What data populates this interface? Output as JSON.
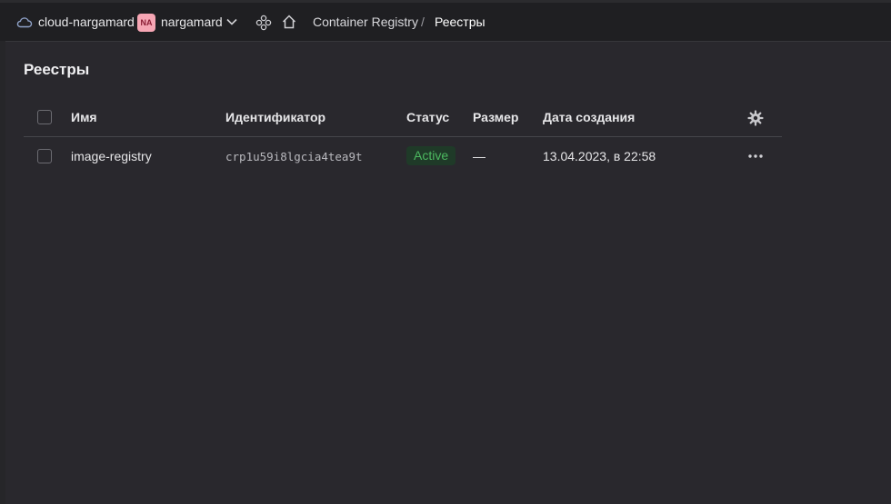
{
  "header": {
    "cloud_name": "cloud-nargamard",
    "folder_avatar": "NA",
    "folder_name": "nargamard",
    "breadcrumb": [
      {
        "label": "Container Registry"
      },
      {
        "label": "Реестры"
      }
    ],
    "breadcrumb_separator": "/"
  },
  "page": {
    "title": "Реестры"
  },
  "table": {
    "columns": [
      "Имя",
      "Идентификатор",
      "Статус",
      "Размер",
      "Дата создания"
    ],
    "rows": [
      {
        "name": "image-registry",
        "id": "crp1u59i8lgcia4tea9t",
        "status": "Active",
        "size": "—",
        "created": "13.04.2023, в 22:58"
      }
    ]
  },
  "colors": {
    "status_active_text": "#4cb860",
    "status_active_bg": "#1f3a28",
    "avatar_bg": "#f6a6b4"
  },
  "icons": [
    "cloud-icon",
    "chevron-down-icon",
    "services-icon",
    "home-icon",
    "gear-icon",
    "more-icon"
  ]
}
